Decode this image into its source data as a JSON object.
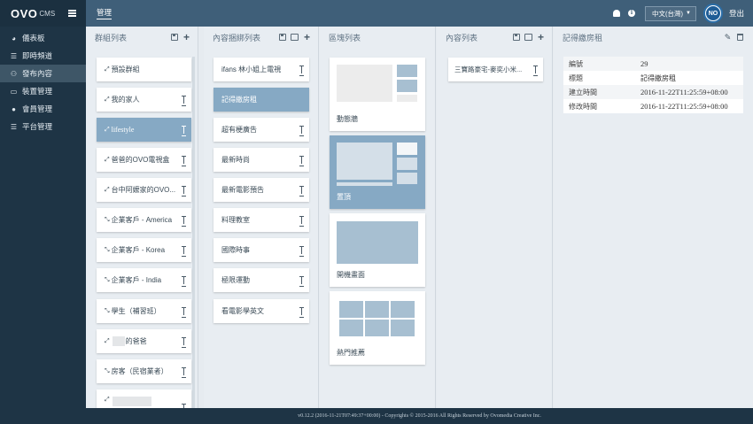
{
  "brand": {
    "logo": "OVO",
    "cms": "CMS"
  },
  "sidebar": {
    "items": [
      {
        "icon": "dashboard-icon",
        "label": "儀表板"
      },
      {
        "icon": "list-icon",
        "label": "即時頻道"
      },
      {
        "icon": "sitemap-icon",
        "label": "發布內容"
      },
      {
        "icon": "desktop-icon",
        "label": "裝置管理"
      },
      {
        "icon": "user-icon",
        "label": "會員管理"
      },
      {
        "icon": "list-icon",
        "label": "平台管理"
      }
    ]
  },
  "header": {
    "breadcrumb": "管理",
    "language": "中文(台灣)",
    "avatar": "NO",
    "logout": "登出"
  },
  "groups": {
    "title": "群組列表",
    "items": [
      "預設群組",
      "我的家人",
      "lifestyle",
      "爸爸的OVO電視盒",
      "台中阿嬤家的OVO...",
      "企業客戶 - America",
      "企業客戶 - Korea",
      "企業客戶 - India",
      "學生（補習班）",
      "的爸爸",
      "房客（民宿業者）"
    ]
  },
  "bindings": {
    "title": "內容捆綁列表",
    "items": [
      "ifans 林小姐上電視",
      "記得繳房租",
      "超有梗廣告",
      "最新時尚",
      "最新電影預告",
      "料理教室",
      "國際時事",
      "極限運動",
      "看電影學英文"
    ]
  },
  "layouts": {
    "title": "區塊列表",
    "items": [
      "動態牆",
      "置頂",
      "開機畫面",
      "熱門推薦"
    ]
  },
  "contents": {
    "title": "內容列表",
    "items": [
      "三寶路豪宅-麥奕小米..."
    ]
  },
  "detail": {
    "title": "記得繳房租",
    "rows": [
      {
        "key": "編號",
        "value": "29"
      },
      {
        "key": "標題",
        "value": "記得繳房租"
      },
      {
        "key": "建立時間",
        "value": "2016-11-22T11:25:59+08:00"
      },
      {
        "key": "修改時間",
        "value": "2016-11-22T11:25:59+08:00"
      }
    ]
  },
  "footer": "v0.12.2 (2016-11-21T07:49:37+00:00) - Copyrights © 2015-2016 All Rights Reserved by Ovomedia Creative Inc.",
  "colors": {
    "sidebar": "#1e3445",
    "topbar": "#3f5f79",
    "selected": "#86a9c4",
    "background": "#e6ebf0"
  }
}
